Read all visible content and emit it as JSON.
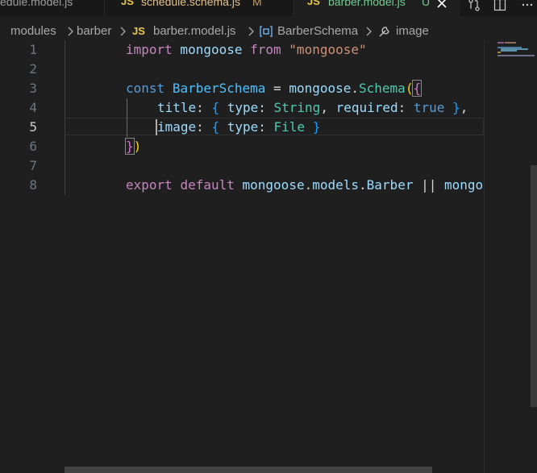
{
  "tabs": [
    {
      "label": "edule.model.js",
      "icon": "js-file-icon",
      "state": "inactive"
    },
    {
      "label": "schedule.schema.js",
      "icon": "js-file-icon",
      "state": "inactive",
      "status": "M"
    },
    {
      "label": "barber.model.js",
      "icon": "js-file-icon",
      "state": "active",
      "status": "U"
    }
  ],
  "tab_js_badge": "JS",
  "tab_close": "×",
  "toolbar": {
    "icons": [
      "compare-changes-icon",
      "split-editor-icon"
    ]
  },
  "breadcrumb": {
    "items": [
      "modules",
      "barber",
      "barber.model.js",
      "BarberSchema",
      "image"
    ],
    "js_badge": "JS"
  },
  "editor": {
    "line_numbers": [
      "1",
      "2",
      "3",
      "4",
      "5",
      "6",
      "7",
      "8"
    ],
    "current_line": 5,
    "lines": {
      "l1": {
        "t1": "import",
        "t2": " mongoose ",
        "t3": "from",
        "t4": " ",
        "t5": "\"mongoose\""
      },
      "l3": {
        "t1": "const",
        "t2": " ",
        "t3": "BarberSchema",
        "t4": " = ",
        "t5": "mongoose",
        "t6": ".",
        "t7": "Schema",
        "t8": "(",
        "t9": "{"
      },
      "l4": {
        "t1": "title",
        "t2": ": ",
        "t3": "{",
        "t4": " ",
        "t5": "type",
        "t6": ": ",
        "t7": "String",
        "t8": ", ",
        "t9": "required",
        "t10": ": ",
        "t11": "true",
        "t12": " ",
        "t13": "}",
        "t14": ","
      },
      "l5": {
        "t1": "image",
        "t2": ": ",
        "t3": "{",
        "t4": " ",
        "t5": "type",
        "t6": ": ",
        "t7": "File",
        "t8": " ",
        "t9": "}"
      },
      "l6": {
        "t1": "}",
        "t2": ")"
      },
      "l8": {
        "t1": "export",
        "t2": " ",
        "t3": "default",
        "t4": " ",
        "t5": "mongoose",
        "t6": ".",
        "t7": "models",
        "t8": ".",
        "t9": "Barber",
        "t10": " || ",
        "t11": "mongo"
      }
    }
  },
  "colors": {
    "background": "#1f1f1f",
    "keyword": "#c586c0",
    "string": "#ce9178",
    "storage": "#569cd6",
    "variable": "#9cdcfe",
    "type": "#4ec9b0",
    "bracket_gold": "#ffd700",
    "bracket_purple": "#da70d6",
    "bracket_blue": "#179fff",
    "js_badge": "#e8c94b"
  }
}
